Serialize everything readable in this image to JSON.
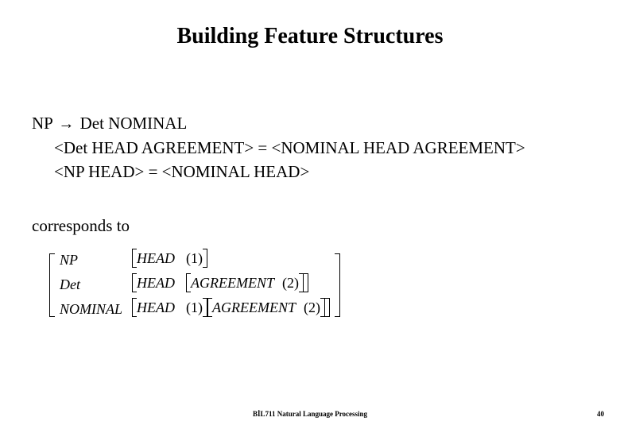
{
  "title": "Building Feature Structures",
  "rule": {
    "lhs": "NP",
    "arrow": "→",
    "rhs": "Det NOMINAL"
  },
  "constraints": [
    "<Det HEAD AGREEMENT> = <NOMINAL  HEAD AGREEMENT>",
    "<NP HEAD> = <NOMINAL  HEAD>"
  ],
  "corresponds": "corresponds to",
  "matrix": {
    "rows": [
      {
        "label": "NP",
        "head": "HEAD",
        "head_val": "(1)",
        "agr": null,
        "agr_val": null
      },
      {
        "label": "Det",
        "head": "HEAD",
        "head_val": null,
        "agr": "AGREEMENT",
        "agr_val": "(2)"
      },
      {
        "label": "NOMINAL",
        "head": "HEAD",
        "head_val": "(1)",
        "agr": "AGREEMENT",
        "agr_val": "(2)"
      }
    ]
  },
  "footer": {
    "course": "BİL711 Natural Language Processing",
    "page": "40"
  }
}
